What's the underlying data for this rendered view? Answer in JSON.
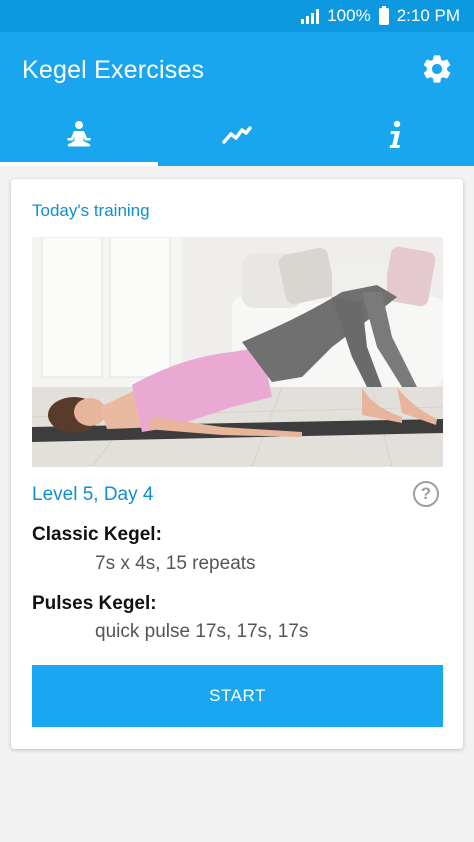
{
  "status_bar": {
    "battery": "100%",
    "time": "2:10 PM"
  },
  "app_bar": {
    "title": "Kegel Exercises",
    "settings_icon": "gear-icon",
    "tabs": [
      {
        "icon": "meditation-icon",
        "active": true
      },
      {
        "icon": "chart-line-icon",
        "active": false
      },
      {
        "icon": "info-icon",
        "active": false
      }
    ]
  },
  "training": {
    "title": "Today's training",
    "level": "Level 5, Day 4",
    "help_icon_text": "?",
    "exercises": [
      {
        "name": "Classic Kegel:",
        "detail": "7s x 4s, 15 repeats"
      },
      {
        "name": "Pulses Kegel:",
        "detail": "quick pulse 17s, 17s, 17s"
      }
    ],
    "start_label": "START"
  },
  "colors": {
    "primary": "#1aa6ee",
    "status_bar": "#0d99e0",
    "accent_text": "#0e8fd0"
  }
}
